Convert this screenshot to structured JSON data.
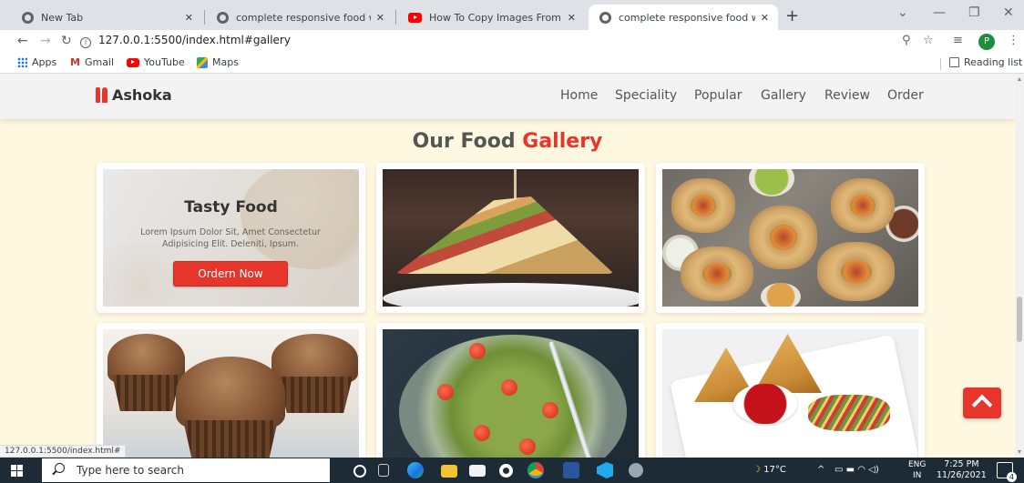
{
  "browser": {
    "tabs": [
      {
        "title": "New Tab",
        "active": false
      },
      {
        "title": "complete responsive food websi",
        "active": false
      },
      {
        "title": "How To Copy Images From Word",
        "active": false
      },
      {
        "title": "complete responsive food websi",
        "active": true
      }
    ],
    "url": "127.0.0.1:5500/index.html#gallery",
    "bookmarks": [
      "Apps",
      "Gmail",
      "YouTube",
      "Maps"
    ],
    "reading_list": "Reading list",
    "profile_initial": "P",
    "status_url": "127.0.0.1:5500/index.html#"
  },
  "site": {
    "logo": "Ashoka",
    "nav": [
      "Home",
      "Speciality",
      "Popular",
      "Gallery",
      "Review",
      "Order"
    ],
    "gallery_title": {
      "main": "Our Food",
      "accent": "Gallery"
    },
    "featured_card": {
      "title": "Tasty Food",
      "description": "Lorem Ipsum Dolor Sit, Amet Consectetur Adipisicing Elit. Deleniti, Ipsum.",
      "button": "Ordern Now"
    },
    "gallery_images": [
      "sandwich",
      "burrito-wraps",
      "cupcakes",
      "zucchini-noodle-salad",
      "samosa-with-chutney"
    ]
  },
  "taskbar": {
    "search_placeholder": "Type here to search",
    "temperature": "17°C",
    "lang_top": "ENG",
    "lang_bottom": "IN",
    "time": "7:25 PM",
    "date": "11/26/2021",
    "notifications": "4"
  },
  "colors": {
    "accent": "#e8352c",
    "page_bg": "#fff8e1",
    "header_bg": "#f3f3f3",
    "taskbar_bg": "#1c2b36"
  }
}
